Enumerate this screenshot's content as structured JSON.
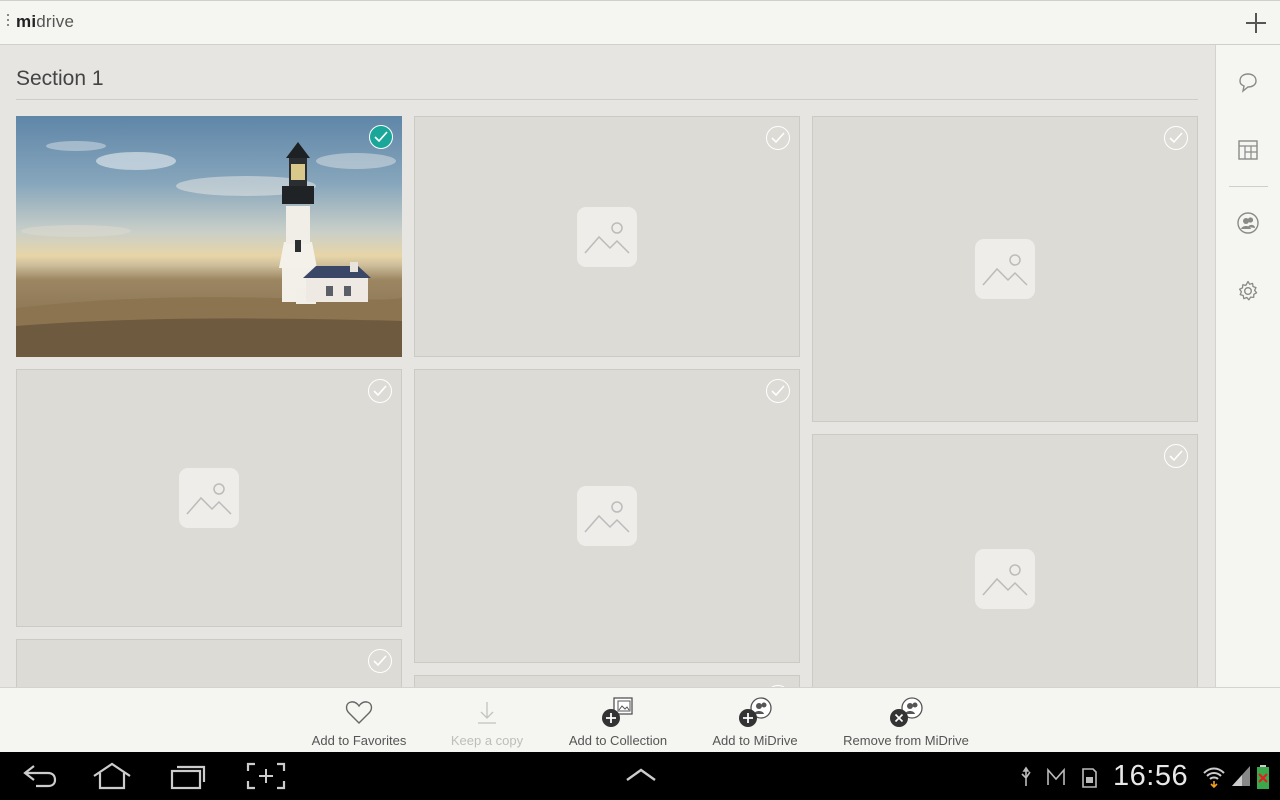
{
  "app": {
    "logo_bold": "mi",
    "logo_light": "drive"
  },
  "section": {
    "title": "Section 1"
  },
  "tiles": [
    {
      "id": "tile-1",
      "type": "photo",
      "selected": true
    },
    {
      "id": "tile-2",
      "type": "placeholder",
      "selected": false
    },
    {
      "id": "tile-3",
      "type": "placeholder",
      "selected": false
    },
    {
      "id": "tile-4",
      "type": "placeholder",
      "selected": false
    },
    {
      "id": "tile-5",
      "type": "placeholder",
      "selected": false
    },
    {
      "id": "tile-6",
      "type": "placeholder",
      "selected": false
    },
    {
      "id": "tile-7",
      "type": "placeholder",
      "selected": false
    },
    {
      "id": "tile-8",
      "type": "placeholder",
      "selected": false
    }
  ],
  "rail": {
    "icons": [
      "chat-icon",
      "layout-icon",
      "people-icon",
      "gear-icon"
    ]
  },
  "actions": [
    {
      "label": "Add to Favorites",
      "icon": "heart-icon",
      "enabled": true
    },
    {
      "label": "Keep a copy",
      "icon": "download-icon",
      "enabled": false
    },
    {
      "label": "Add to Collection",
      "icon": "add-collection-icon",
      "enabled": true
    },
    {
      "label": "Add to MiDrive",
      "icon": "add-midrive-icon",
      "enabled": true
    },
    {
      "label": "Remove from MiDrive",
      "icon": "remove-midrive-icon",
      "enabled": true
    }
  ],
  "system": {
    "time": "16:56",
    "status_icons": [
      "usb-icon",
      "gmail-icon",
      "sd-card-icon",
      "wifi-icon",
      "signal-icon",
      "battery-icon"
    ],
    "nav_buttons": [
      "back-icon",
      "home-icon",
      "recents-icon",
      "screenshot-icon",
      "up-arrow-icon"
    ]
  },
  "colors": {
    "accent": "#1aa79a",
    "tile_bg": "#dcdbd6",
    "page_bg": "#e6e5e1"
  }
}
